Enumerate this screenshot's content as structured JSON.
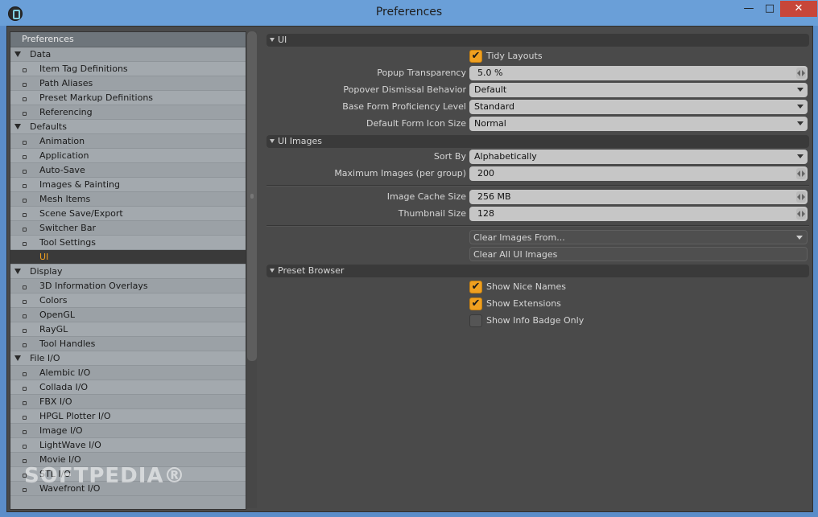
{
  "window": {
    "title": "Preferences",
    "minimize": "—",
    "maximize": "□",
    "close": "✕"
  },
  "tree": {
    "header": "Preferences",
    "rows": [
      {
        "type": "group",
        "label": "Data"
      },
      {
        "type": "leaf",
        "label": "Item Tag Definitions"
      },
      {
        "type": "leaf",
        "label": "Path Aliases"
      },
      {
        "type": "leaf",
        "label": "Preset Markup Definitions"
      },
      {
        "type": "leaf",
        "label": "Referencing"
      },
      {
        "type": "group",
        "label": "Defaults"
      },
      {
        "type": "leaf",
        "label": "Animation"
      },
      {
        "type": "leaf",
        "label": "Application"
      },
      {
        "type": "leaf",
        "label": "Auto-Save"
      },
      {
        "type": "leaf",
        "label": "Images & Painting"
      },
      {
        "type": "leaf",
        "label": "Mesh Items"
      },
      {
        "type": "leaf",
        "label": "Scene Save/Export"
      },
      {
        "type": "leaf",
        "label": "Switcher Bar"
      },
      {
        "type": "leaf",
        "label": "Tool Settings"
      },
      {
        "type": "leaf",
        "label": "UI",
        "selected": true
      },
      {
        "type": "group",
        "label": "Display"
      },
      {
        "type": "leaf",
        "label": "3D Information Overlays"
      },
      {
        "type": "leaf",
        "label": "Colors"
      },
      {
        "type": "leaf",
        "label": "OpenGL"
      },
      {
        "type": "leaf",
        "label": "RayGL"
      },
      {
        "type": "leaf",
        "label": "Tool Handles"
      },
      {
        "type": "group",
        "label": "File I/O"
      },
      {
        "type": "leaf",
        "label": "Alembic I/O"
      },
      {
        "type": "leaf",
        "label": "Collada I/O"
      },
      {
        "type": "leaf",
        "label": "FBX I/O"
      },
      {
        "type": "leaf",
        "label": "HPGL Plotter I/O"
      },
      {
        "type": "leaf",
        "label": "Image I/O"
      },
      {
        "type": "leaf",
        "label": "LightWave I/O"
      },
      {
        "type": "leaf",
        "label": "Movie I/O"
      },
      {
        "type": "leaf",
        "label": "STL I/O"
      },
      {
        "type": "leaf",
        "label": "Wavefront I/O"
      }
    ]
  },
  "ui_section": {
    "title": "UI",
    "tidy_layouts": {
      "label": "Tidy Layouts",
      "checked": true
    },
    "popup_transparency": {
      "label": "Popup Transparency",
      "value": "5.0 %"
    },
    "popover_dismissal": {
      "label": "Popover Dismissal Behavior",
      "value": "Default"
    },
    "base_form_proficiency": {
      "label": "Base Form Proficiency Level",
      "value": "Standard"
    },
    "default_form_icon_size": {
      "label": "Default Form Icon Size",
      "value": "Normal"
    }
  },
  "ui_images_section": {
    "title": "UI Images",
    "sort_by": {
      "label": "Sort By",
      "value": "Alphabetically"
    },
    "max_images": {
      "label": "Maximum Images (per group)",
      "value": "200"
    },
    "image_cache_size": {
      "label": "Image Cache Size",
      "value": "256 MB"
    },
    "thumbnail_size": {
      "label": "Thumbnail Size",
      "value": "128"
    },
    "clear_images_from": "Clear Images From...",
    "clear_all": "Clear All UI Images"
  },
  "preset_browser_section": {
    "title": "Preset Browser",
    "show_nice_names": {
      "label": "Show Nice Names",
      "checked": true
    },
    "show_extensions": {
      "label": "Show Extensions",
      "checked": true
    },
    "show_info_badge_only": {
      "label": "Show Info Badge Only",
      "checked": false
    }
  },
  "check_glyph": "✔",
  "watermark": "SOFTPEDIA®",
  "colors": {
    "accent": "#f0a020",
    "selection_bg": "#3a3a3a",
    "panel_bg": "#4a4a4a",
    "tree_bg": "#9ba1a6"
  }
}
